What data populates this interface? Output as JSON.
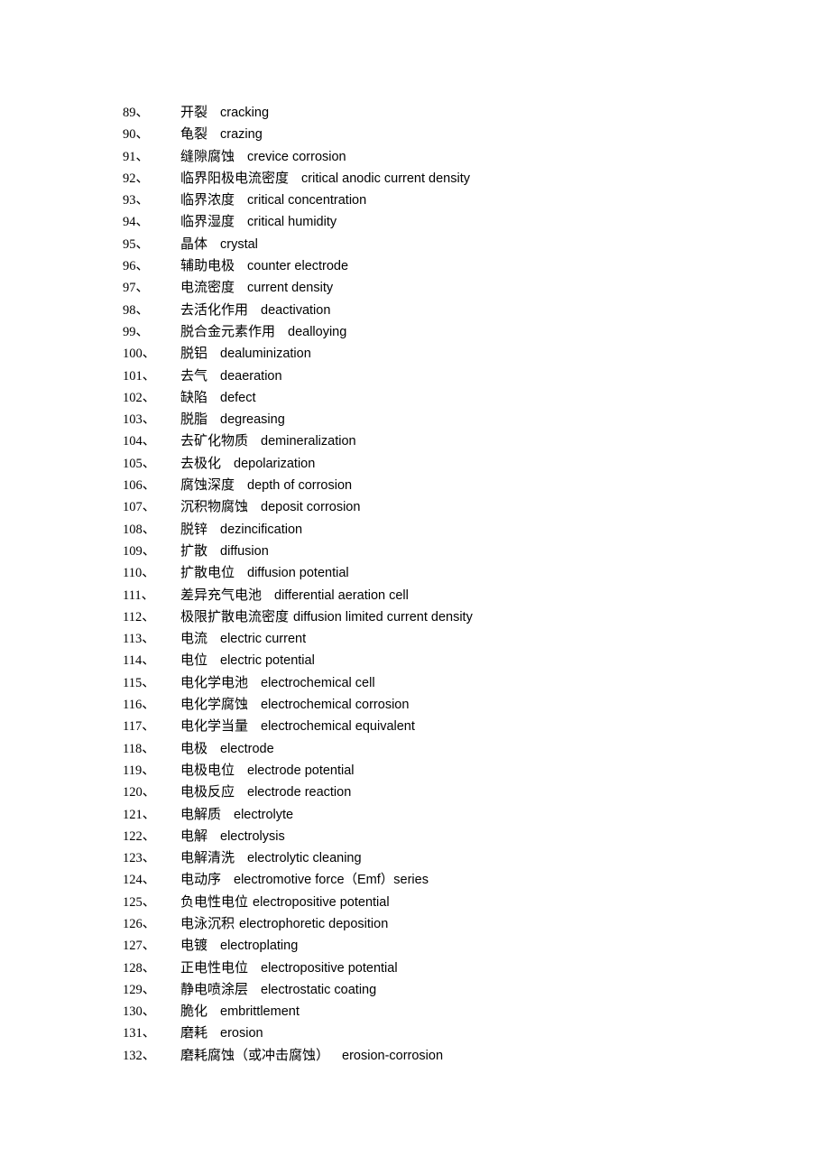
{
  "document": {
    "type": "glossary",
    "language_pair": "Chinese-English",
    "subject": "corrosion science terminology",
    "entries": [
      {
        "index": "89、",
        "term": "开裂",
        "definition": "cracking",
        "gap": "wide"
      },
      {
        "index": "90、",
        "term": "龟裂",
        "definition": "crazing",
        "gap": "wide"
      },
      {
        "index": "91、",
        "term": "缝隙腐蚀",
        "definition": "crevice corrosion",
        "gap": "wide"
      },
      {
        "index": "92、",
        "term": "临界阳极电流密度",
        "definition": "critical anodic current density",
        "gap": "wide"
      },
      {
        "index": "93、",
        "term": "临界浓度",
        "definition": "critical concentration",
        "gap": "wide"
      },
      {
        "index": "94、",
        "term": "临界湿度",
        "definition": "critical humidity",
        "gap": "wide"
      },
      {
        "index": "95、",
        "term": "晶体",
        "definition": "crystal",
        "gap": "wide"
      },
      {
        "index": "96、",
        "term": "辅助电极",
        "definition": "counter electrode",
        "gap": "wide"
      },
      {
        "index": "97、",
        "term": "电流密度",
        "definition": "current density",
        "gap": "wide"
      },
      {
        "index": "98、",
        "term": "去活化作用",
        "definition": "deactivation",
        "gap": "wide"
      },
      {
        "index": "99、",
        "term": "脱合金元素作用",
        "definition": "dealloying",
        "gap": "wide"
      },
      {
        "index": "100、",
        "term": "脱铝",
        "definition": "dealuminization",
        "gap": "wide"
      },
      {
        "index": "101、",
        "term": "去气",
        "definition": "deaeration",
        "gap": "wide"
      },
      {
        "index": "102、",
        "term": "缺陷",
        "definition": "defect",
        "gap": "wide"
      },
      {
        "index": "103、",
        "term": "脱脂",
        "definition": "degreasing",
        "gap": "wide"
      },
      {
        "index": "104、",
        "term": "去矿化物质",
        "definition": "demineralization",
        "gap": "wide"
      },
      {
        "index": "105、",
        "term": "去极化",
        "definition": "depolarization",
        "gap": "wide"
      },
      {
        "index": "106、",
        "term": "腐蚀深度",
        "definition": "depth of corrosion",
        "gap": "wide"
      },
      {
        "index": "107、",
        "term": "沉积物腐蚀",
        "definition": "deposit corrosion",
        "gap": "wide"
      },
      {
        "index": "108、",
        "term": "脱锌",
        "definition": "dezincification",
        "gap": "wide"
      },
      {
        "index": "109、",
        "term": "扩散",
        "definition": "diffusion",
        "gap": "wide"
      },
      {
        "index": "110、",
        "term": "扩散电位",
        "definition": "diffusion potential",
        "gap": "wide"
      },
      {
        "index": "111、",
        "term": "差异充气电池",
        "definition": "differential aeration cell",
        "gap": "wide"
      },
      {
        "index": "112、",
        "term": "极限扩散电流密度",
        "definition": "diffusion limited current density",
        "gap": "narrow"
      },
      {
        "index": "113、",
        "term": "电流",
        "definition": "electric current",
        "gap": "wide"
      },
      {
        "index": "114、",
        "term": "电位",
        "definition": "electric potential",
        "gap": "wide"
      },
      {
        "index": "115、",
        "term": "电化学电池",
        "definition": "electrochemical cell",
        "gap": "wide"
      },
      {
        "index": "116、",
        "term": "电化学腐蚀",
        "definition": "electrochemical corrosion",
        "gap": "wide"
      },
      {
        "index": "117、",
        "term": "电化学当量",
        "definition": "electrochemical equivalent",
        "gap": "wide"
      },
      {
        "index": "118、",
        "term": "电极",
        "definition": "electrode",
        "gap": "wide"
      },
      {
        "index": "119、",
        "term": "电极电位",
        "definition": "electrode potential",
        "gap": "wide"
      },
      {
        "index": "120、",
        "term": "电极反应",
        "definition": "electrode reaction",
        "gap": "wide"
      },
      {
        "index": "121、",
        "term": "电解质",
        "definition": "electrolyte",
        "gap": "wide"
      },
      {
        "index": "122、",
        "term": "电解",
        "definition": "electrolysis",
        "gap": "wide"
      },
      {
        "index": "123、",
        "term": "电解清洗",
        "definition": "electrolytic cleaning",
        "gap": "wide"
      },
      {
        "index": "124、",
        "term": "电动序",
        "definition": "electromotive force（Emf）series",
        "gap": "wide"
      },
      {
        "index": "125、",
        "term": "负电性电位",
        "definition": "electropositive potential",
        "gap": "narrow"
      },
      {
        "index": "126、",
        "term": "电泳沉积",
        "definition": "electrophoretic deposition",
        "gap": "narrow"
      },
      {
        "index": "127、",
        "term": "电镀",
        "definition": "electroplating",
        "gap": "wide"
      },
      {
        "index": "128、",
        "term": "正电性电位",
        "definition": "electropositive potential",
        "gap": "wide"
      },
      {
        "index": "129、",
        "term": "静电喷涂层",
        "definition": "electrostatic coating",
        "gap": "wide"
      },
      {
        "index": "130、",
        "term": "脆化",
        "definition": "embrittlement",
        "gap": "wide"
      },
      {
        "index": "131、",
        "term": "磨耗",
        "definition": "erosion",
        "gap": "wide"
      },
      {
        "index": "132、",
        "term": "磨耗腐蚀（或冲击腐蚀）",
        "definition": "erosion-corrosion",
        "gap": "wide"
      }
    ]
  }
}
